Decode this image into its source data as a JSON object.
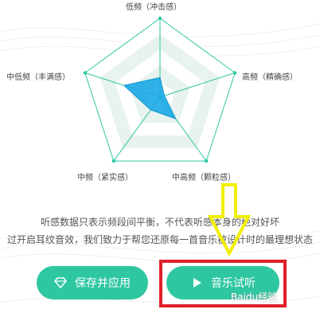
{
  "radar": {
    "axes": [
      {
        "label": "低频（冲击感）",
        "value": 0.25
      },
      {
        "label": "高频（精确感）",
        "value": 0.06
      },
      {
        "label": "中高频（颗粒感）",
        "value": 0.34
      },
      {
        "label": "中频（紧实感）",
        "value": 0.2
      },
      {
        "label": "中低频（丰满感）",
        "value": 0.48
      }
    ],
    "colors": {
      "outline": "#2fc7a2",
      "ring": "#e8f3f0",
      "fill": "#1aa8e6"
    }
  },
  "description": {
    "line1": "听感数据只表示频段间平衡，不代表听感本身的绝对好坏",
    "line2": "过开启耳纹音效，我们致力于帮您还原每一首音乐被设计时的最理想状态"
  },
  "buttons": {
    "save_apply": "保存并应用",
    "music_trial": "音乐试听"
  },
  "watermark": "Baidu经验",
  "colors": {
    "accent": "#2fc7a2",
    "annotation_red": "#e0202a",
    "annotation_yellow": "#f2ee00"
  },
  "icons": {
    "save": "diamond-icon",
    "play": "play-icon"
  }
}
